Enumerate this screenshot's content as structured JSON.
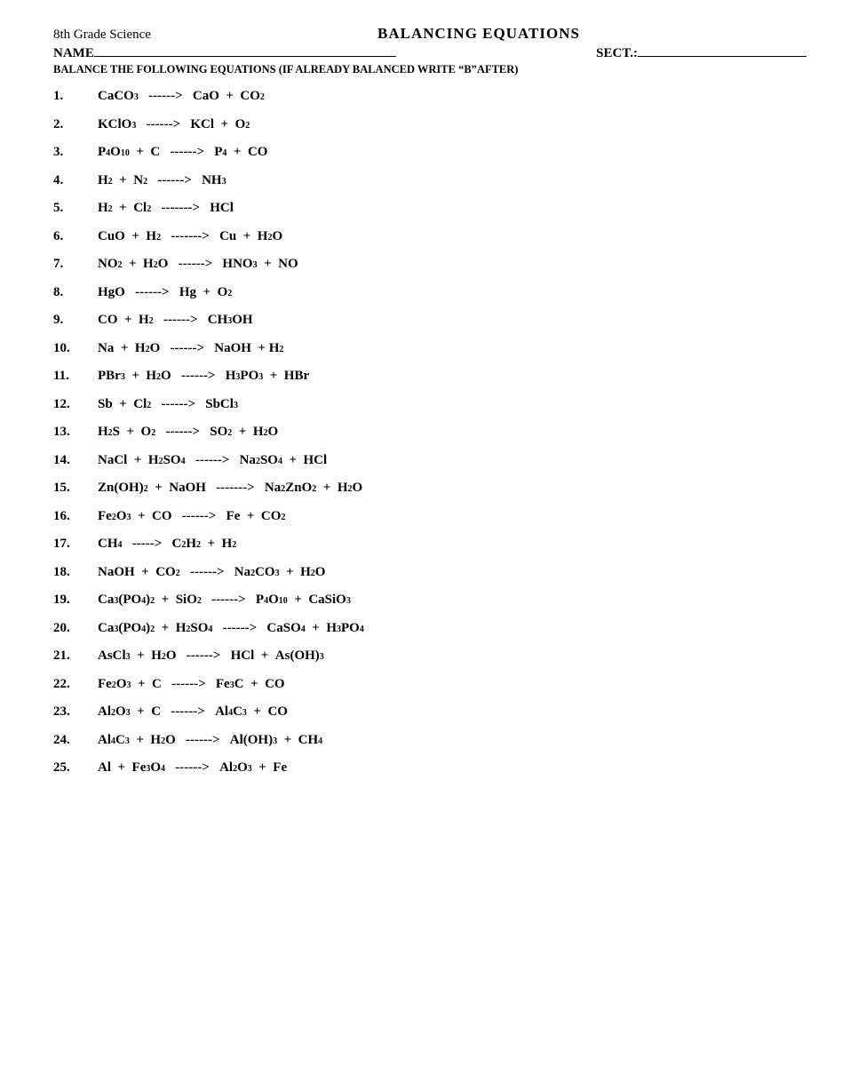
{
  "header": {
    "left": "8th Grade Science",
    "center": "BALANCING EQUATIONS"
  },
  "nameLabel": "NAME",
  "sectLabel": "SECT.:",
  "instruction": "BALANCE THE FOLLOWING EQUATIONS (IF ALREADY BALANCED WRITE “B”AFTER)"
}
